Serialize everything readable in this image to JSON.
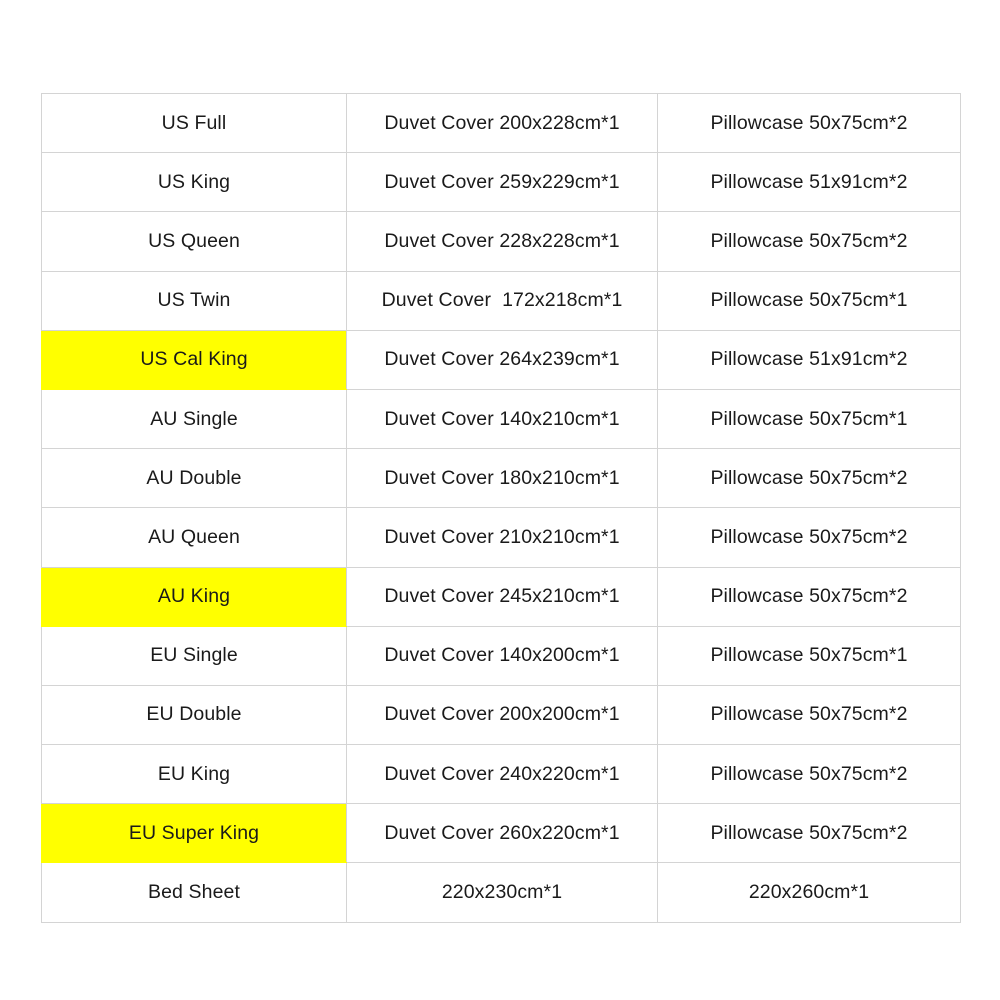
{
  "table": {
    "highlight_color": "#ffff00",
    "border_color": "#d4d4d4",
    "text_color": "#1a1a1a",
    "background_color": "#ffffff",
    "columns": [
      "size",
      "duvet_cover",
      "pillowcase"
    ],
    "rows": [
      {
        "size": "US Full",
        "duvet": "Duvet Cover 200x228cm*1",
        "pillow": "Pillowcase 50x75cm*2",
        "highlighted": false
      },
      {
        "size": "US King",
        "duvet": "Duvet Cover 259x229cm*1",
        "pillow": "Pillowcase 51x91cm*2",
        "highlighted": false
      },
      {
        "size": "US Queen",
        "duvet": "Duvet Cover 228x228cm*1",
        "pillow": "Pillowcase 50x75cm*2",
        "highlighted": false
      },
      {
        "size": "US Twin",
        "duvet": "Duvet Cover  172x218cm*1",
        "pillow": "Pillowcase 50x75cm*1",
        "highlighted": false
      },
      {
        "size": "US Cal King",
        "duvet": "Duvet Cover 264x239cm*1",
        "pillow": "Pillowcase 51x91cm*2",
        "highlighted": true
      },
      {
        "size": "AU Single",
        "duvet": "Duvet Cover 140x210cm*1",
        "pillow": "Pillowcase 50x75cm*1",
        "highlighted": false
      },
      {
        "size": "AU Double",
        "duvet": "Duvet Cover 180x210cm*1",
        "pillow": "Pillowcase 50x75cm*2",
        "highlighted": false
      },
      {
        "size": "AU Queen",
        "duvet": "Duvet Cover 210x210cm*1",
        "pillow": "Pillowcase 50x75cm*2",
        "highlighted": false
      },
      {
        "size": "AU King",
        "duvet": "Duvet Cover 245x210cm*1",
        "pillow": "Pillowcase 50x75cm*2",
        "highlighted": true
      },
      {
        "size": "EU Single",
        "duvet": "Duvet Cover 140x200cm*1",
        "pillow": "Pillowcase 50x75cm*1",
        "highlighted": false
      },
      {
        "size": "EU Double",
        "duvet": "Duvet Cover 200x200cm*1",
        "pillow": "Pillowcase 50x75cm*2",
        "highlighted": false
      },
      {
        "size": "EU King",
        "duvet": "Duvet Cover 240x220cm*1",
        "pillow": "Pillowcase 50x75cm*2",
        "highlighted": false
      },
      {
        "size": "EU Super King",
        "duvet": "Duvet Cover 260x220cm*1",
        "pillow": "Pillowcase 50x75cm*2",
        "highlighted": true
      },
      {
        "size": "Bed Sheet",
        "duvet": "220x230cm*1",
        "pillow": "220x260cm*1",
        "highlighted": false
      }
    ]
  }
}
